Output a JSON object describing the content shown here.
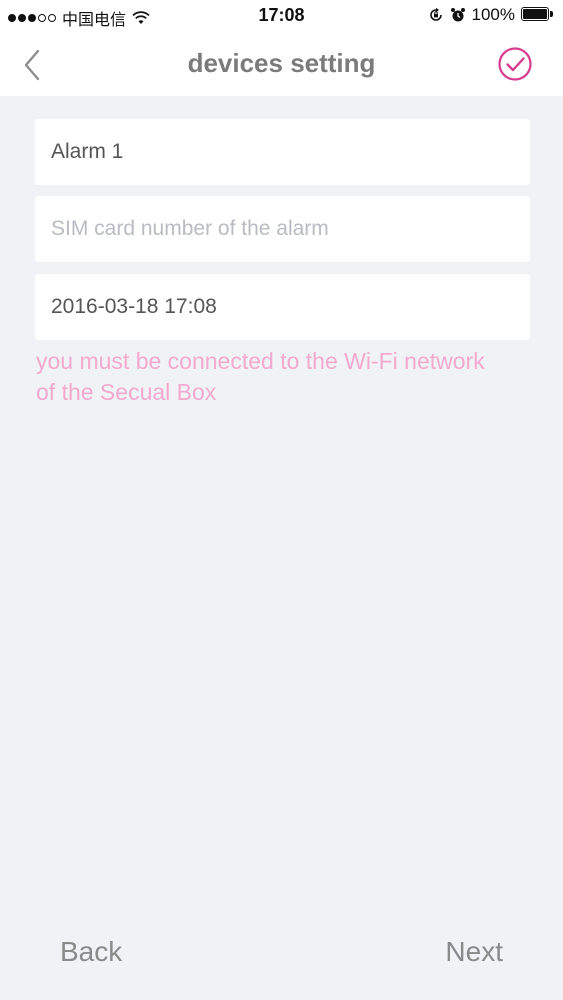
{
  "status_bar": {
    "carrier": "中国电信",
    "time": "17:08",
    "battery": "100%",
    "signal_strength": 3,
    "signal_total": 5,
    "icons": [
      "wifi-icon",
      "rotation-lock-icon",
      "alarm-clock-icon",
      "battery-icon"
    ]
  },
  "nav": {
    "title": "devices setting",
    "back_icon": "chevron-left-icon",
    "confirm_icon": "check-circle-icon",
    "accent_color": "#d63b8f"
  },
  "form": {
    "name_value": "Alarm 1",
    "sim_value": "",
    "sim_placeholder": "SIM card number of the alarm",
    "date_value": "2016-03-18 17:08"
  },
  "hint": {
    "text": "you must be connected to the Wi-Fi network of the Secual Box",
    "color": "#f4a9cf"
  },
  "footer": {
    "back_label": "Back",
    "next_label": "Next"
  }
}
